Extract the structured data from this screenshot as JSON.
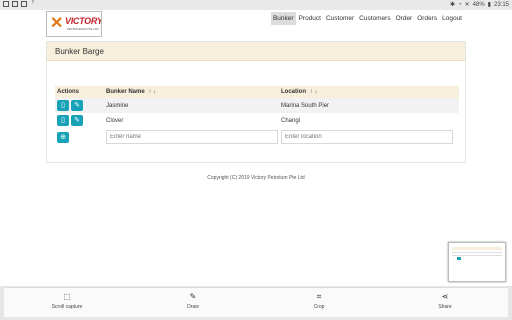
{
  "statusbar": {
    "right": {
      "battery": "48%",
      "time": "23:15"
    }
  },
  "logo": {
    "word": "VICTORY",
    "tag": "PETROLEUM PTE LTD"
  },
  "nav": {
    "items": [
      "Bunker",
      "Product",
      "Customer",
      "Customers",
      "Order",
      "Orders",
      "Logout"
    ]
  },
  "panel": {
    "title": "Bunker Barge"
  },
  "table": {
    "headers": {
      "actions": "Actions",
      "name": "Bunker Name",
      "location": "Location",
      "sort_glyphs": "↑ ↓"
    },
    "rows": [
      {
        "name": "Jasmine",
        "location": "Marina South Pier"
      },
      {
        "name": "Clover",
        "location": "Changi"
      }
    ],
    "new_row": {
      "name_placeholder": "Enter name",
      "location_placeholder": "Enter location"
    }
  },
  "footer": {
    "copyright": "Copyright (C) 2019 Victory Petrolum Pte Ltd"
  },
  "toolbar": {
    "items": [
      {
        "label": "Scroll capture",
        "icon": "scroll-capture-icon"
      },
      {
        "label": "Draw",
        "icon": "pen-icon"
      },
      {
        "label": "Crop",
        "icon": "crop-icon"
      },
      {
        "label": "Share",
        "icon": "share-icon"
      }
    ]
  },
  "colors": {
    "accent": "#17a2b8",
    "header_bg": "#f7efdc",
    "brand_red": "#c0262c",
    "brand_orange": "#e07a18"
  }
}
